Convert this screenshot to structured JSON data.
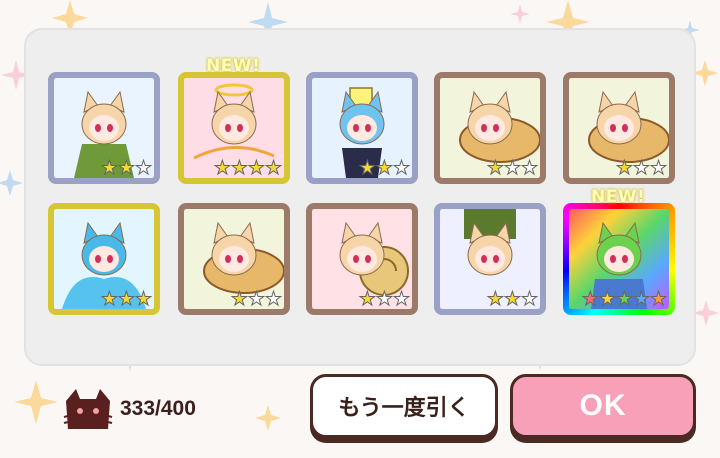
{
  "cards": [
    {
      "id": 1,
      "rarity": 2,
      "frame": "silver",
      "new": false,
      "art": "fox-girl-green-jacket"
    },
    {
      "id": 2,
      "rarity": 4,
      "frame": "gold",
      "new": true,
      "art": "fox-girl-archer-halo"
    },
    {
      "id": 3,
      "rarity": 2,
      "frame": "silver",
      "new": false,
      "art": "blue-haired-girl-sign"
    },
    {
      "id": 4,
      "rarity": 1,
      "frame": "bronze",
      "new": false,
      "art": "fox-girl-taiyaki"
    },
    {
      "id": 5,
      "rarity": 1,
      "frame": "bronze",
      "new": false,
      "art": "fox-girl-taiyaki"
    },
    {
      "id": 6,
      "rarity": 3,
      "frame": "gold",
      "new": false,
      "art": "blue-slime-girl"
    },
    {
      "id": 7,
      "rarity": 1,
      "frame": "bronze",
      "new": false,
      "art": "fox-girl-taiyaki"
    },
    {
      "id": 8,
      "rarity": 1,
      "frame": "bronze",
      "new": false,
      "art": "fox-girl-snail"
    },
    {
      "id": 9,
      "rarity": 2,
      "frame": "silver",
      "new": false,
      "art": "fox-girl-upside-down"
    },
    {
      "id": 10,
      "rarity": 5,
      "frame": "rainbow",
      "new": true,
      "art": "rainbow-fox-girl"
    }
  ],
  "badge": {
    "new_label": "NEW!"
  },
  "counter": {
    "text": "333/400",
    "icon": "cat-silhouette-icon"
  },
  "buttons": {
    "retry_label": "もう一度引く",
    "ok_label": "OK"
  },
  "colors": {
    "ok_button": "#f7a0b8",
    "frame_gold": "#d6c534",
    "frame_silver": "#9aa0c6",
    "frame_bronze": "#9c7a6a"
  }
}
